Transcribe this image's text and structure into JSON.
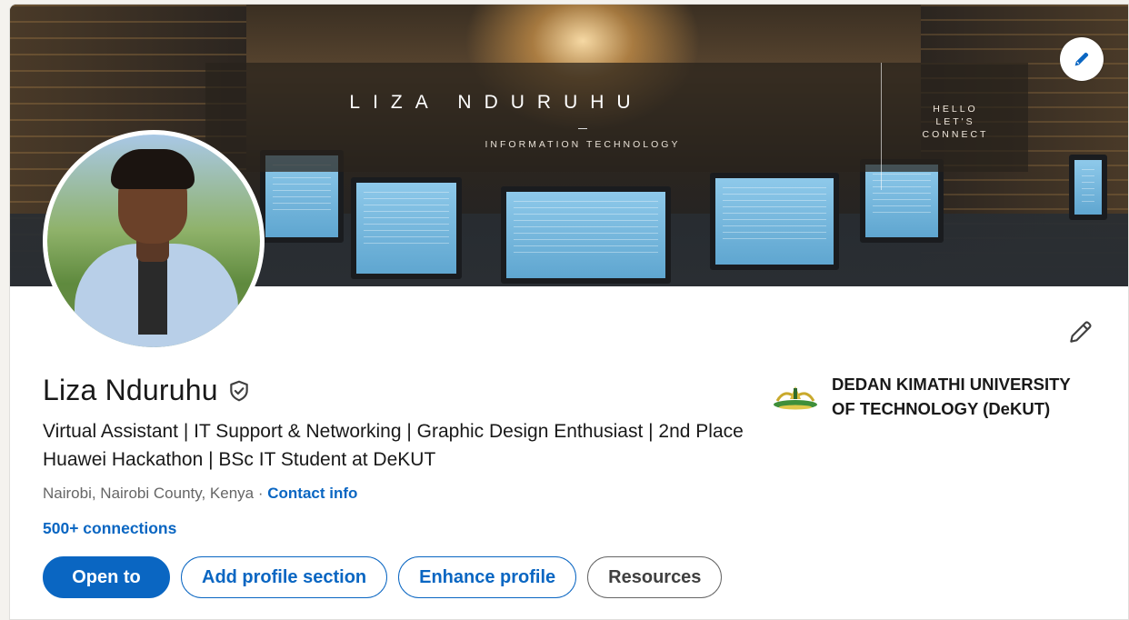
{
  "banner": {
    "title": "LIZA NDURUHU",
    "subtitle": "INFORMATION TECHNOLOGY",
    "side_text": "HELLO\nLET'S\nCONNECT",
    "edit_icon": "pencil-icon"
  },
  "profile": {
    "name": "Liza Nduruhu",
    "verified_icon": "verified-shield-icon",
    "headline": "Virtual Assistant | IT Support & Networking | Graphic Design Enthusiast | 2nd Place Huawei Hackathon | BSc IT Student at DeKUT",
    "location": "Nairobi, Nairobi County, Kenya",
    "separator": " · ",
    "contact_info_label": "Contact info",
    "connections": "500+ connections",
    "edit_icon": "pencil-icon"
  },
  "education": {
    "school": "DEDAN KIMATHI UNIVERSITY\nOF TECHNOLOGY (DeKUT)",
    "logo_icon": "university-logo-icon"
  },
  "actions": {
    "open_to": "Open to",
    "add_section": "Add profile section",
    "enhance": "Enhance profile",
    "resources": "Resources"
  },
  "colors": {
    "primary": "#0a66c2",
    "text": "#191919",
    "muted": "#666666"
  }
}
